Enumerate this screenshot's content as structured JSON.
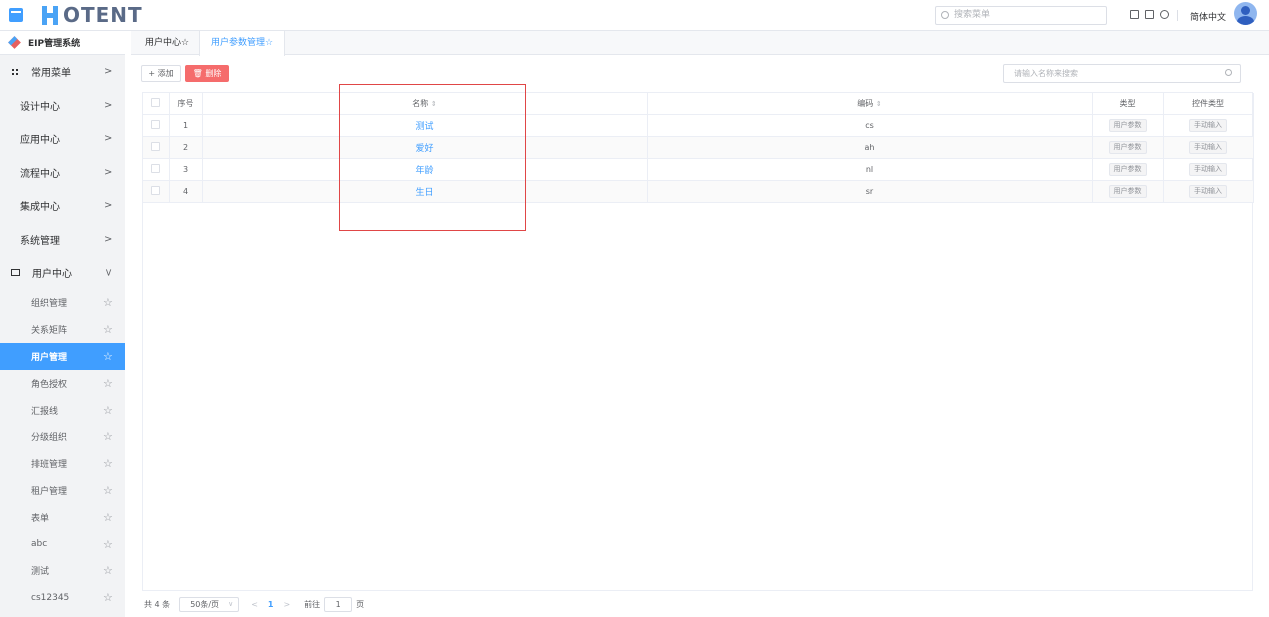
{
  "header": {
    "logo_text": "OTENT",
    "search_placeholder": "搜索菜单",
    "language": "简体中文",
    "icons": [
      "monitor-icon",
      "fullscreen-icon",
      "refresh-icon"
    ]
  },
  "sidebar": {
    "system_name": "EIP管理系统",
    "top_items": [
      {
        "label": "常用菜单",
        "icon": "grid-icon"
      },
      {
        "label": "设计中心"
      },
      {
        "label": "应用中心"
      },
      {
        "label": "流程中心"
      },
      {
        "label": "集成中心"
      },
      {
        "label": "系统管理"
      },
      {
        "label": "用户中心",
        "icon": "monitor-icon",
        "expanded": true
      }
    ],
    "sub_items": [
      {
        "label": "组织管理"
      },
      {
        "label": "关系矩阵"
      },
      {
        "label": "用户管理",
        "active": true
      },
      {
        "label": "角色授权"
      },
      {
        "label": "汇报线"
      },
      {
        "label": "分级组织"
      },
      {
        "label": "排班管理"
      },
      {
        "label": "租户管理"
      },
      {
        "label": "表单"
      },
      {
        "label": "abc"
      },
      {
        "label": "测试"
      },
      {
        "label": "cs12345"
      }
    ]
  },
  "tabs": [
    {
      "label": "用户中心☆"
    },
    {
      "label": "用户参数管理☆",
      "active": true
    }
  ],
  "toolbar": {
    "add_label": "+ 添加",
    "delete_label": "删除",
    "search_placeholder": "请输入名称来搜索"
  },
  "table": {
    "headers": {
      "index": "序号",
      "name": "名称",
      "code": "编码",
      "type": "类型",
      "control_type": "控件类型"
    },
    "rows": [
      {
        "index": "1",
        "name": "测试",
        "code": "cs",
        "type": "用户参数",
        "control_type": "手动输入"
      },
      {
        "index": "2",
        "name": "爱好",
        "code": "ah",
        "type": "用户参数",
        "control_type": "手动输入"
      },
      {
        "index": "3",
        "name": "年龄",
        "code": "nl",
        "type": "用户参数",
        "control_type": "手动输入"
      },
      {
        "index": "4",
        "name": "生日",
        "code": "sr",
        "type": "用户参数",
        "control_type": "手动输入"
      }
    ]
  },
  "pagination": {
    "total": "共 4 条",
    "page_size": "50条/页",
    "current_page": "1",
    "goto_label": "前往",
    "goto_value": "1",
    "page_suffix": "页"
  },
  "colors": {
    "accent": "#409eff",
    "danger": "#f56c6c",
    "annotation": "#e04646"
  }
}
